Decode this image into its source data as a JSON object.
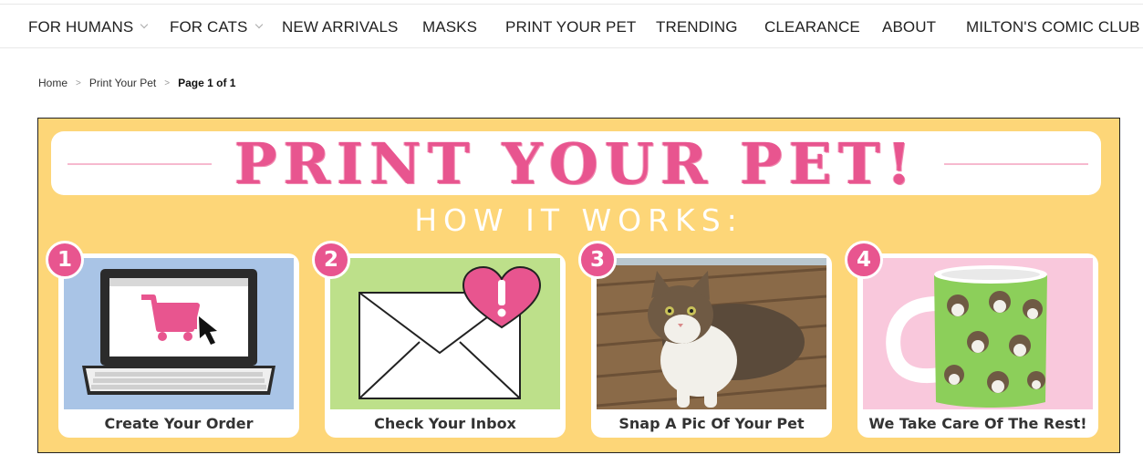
{
  "nav": {
    "items": [
      {
        "label": "FOR HUMANS",
        "has_dropdown": true
      },
      {
        "label": "FOR CATS",
        "has_dropdown": true
      },
      {
        "label": "NEW ARRIVALS",
        "has_dropdown": false
      },
      {
        "label": "MASKS",
        "has_dropdown": false
      },
      {
        "label": "PRINT YOUR PET",
        "has_dropdown": false
      },
      {
        "label": "TRENDING",
        "has_dropdown": false
      },
      {
        "label": "CLEARANCE",
        "has_dropdown": false
      },
      {
        "label": "ABOUT",
        "has_dropdown": false
      },
      {
        "label": "MILTON'S COMIC CLUB",
        "has_dropdown": false
      }
    ]
  },
  "breadcrumb": {
    "home": "Home",
    "section": "Print Your Pet",
    "current": "Page 1 of 1",
    "separator": ">"
  },
  "banner": {
    "title": "PRINT YOUR PET!",
    "subtitle": "HOW IT WORKS:",
    "colors": {
      "background": "#fdd678",
      "accent": "#e8558f"
    },
    "steps": [
      {
        "number": "1",
        "label": "Create Your Order",
        "icon": "laptop-cart-icon",
        "color": "#a9c4e6"
      },
      {
        "number": "2",
        "label": "Check Your Inbox",
        "icon": "envelope-heart-icon",
        "color": "#bde08a"
      },
      {
        "number": "3",
        "label": "Snap A Pic Of Your Pet",
        "icon": "cat-photo",
        "color": "#8a6a48"
      },
      {
        "number": "4",
        "label": "We Take Care Of The Rest!",
        "icon": "cat-mug-icon",
        "color": "#f9c8dc"
      }
    ]
  }
}
